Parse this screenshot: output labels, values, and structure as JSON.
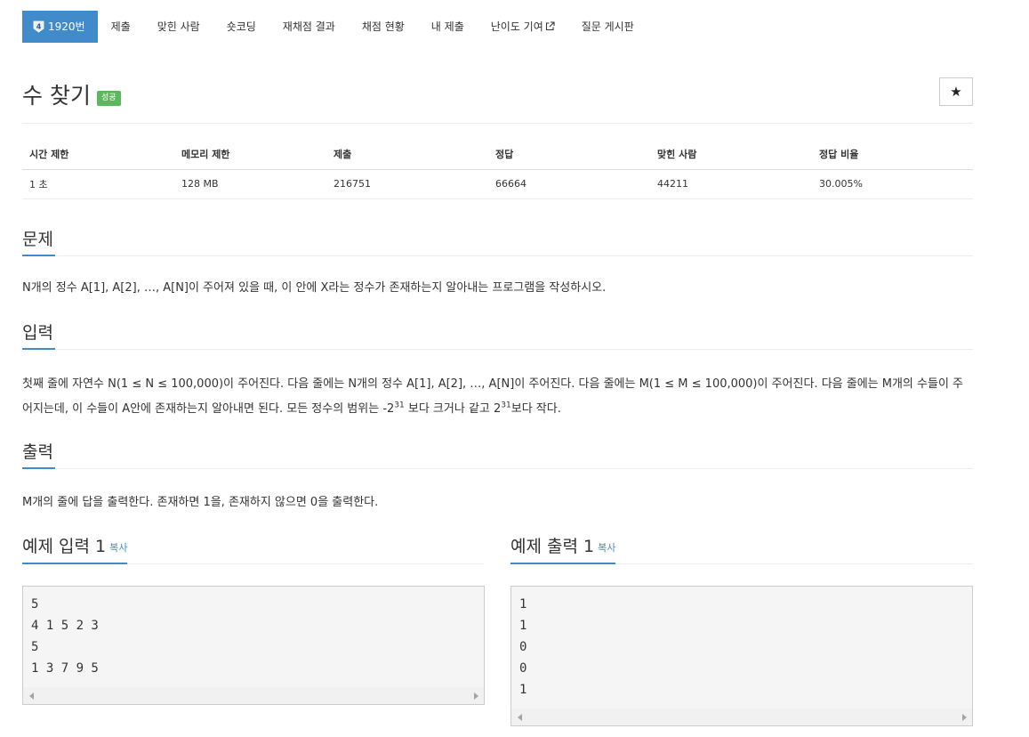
{
  "nav": {
    "active": {
      "tier": "4",
      "label": "1920번"
    },
    "items": [
      "제출",
      "맞힌 사람",
      "숏코딩",
      "재채점 결과",
      "채점 현황",
      "내 제출",
      "난이도 기여",
      "질문 게시판"
    ]
  },
  "problem": {
    "title": "수 찾기",
    "badge": "성공",
    "star": "★"
  },
  "info": {
    "headers": [
      "시간 제한",
      "메모리 제한",
      "제출",
      "정답",
      "맞힌 사람",
      "정답 비율"
    ],
    "values": [
      "1 초",
      "128 MB",
      "216751",
      "66664",
      "44211",
      "30.005%"
    ]
  },
  "sections": {
    "problem_head": "문제",
    "problem_text": "N개의 정수 A[1], A[2], …, A[N]이 주어져 있을 때, 이 안에 X라는 정수가 존재하는지 알아내는 프로그램을 작성하시오.",
    "input_head": "입력",
    "input_text_1": "첫째 줄에 자연수 N(1 ≤ N ≤ 100,000)이 주어진다. 다음 줄에는 N개의 정수 A[1], A[2], …, A[N]이 주어진다. 다음 줄에는 M(1 ≤ M ≤ 100,000)이 주어진다. 다음 줄에는 M개의 수들이 주어지는데, 이 수들이 A안에 존재하는지 알아내면 된다. 모든 정수의 범위는 -2",
    "input_sup_1": "31",
    "input_text_2": " 보다 크거나 같고 2",
    "input_sup_2": "31",
    "input_text_3": "보다 작다.",
    "output_head": "출력",
    "output_text": "M개의 줄에 답을 출력한다. 존재하면 1을, 존재하지 않으면 0을 출력한다."
  },
  "samples": {
    "input_head": "예제 입력 1",
    "output_head": "예제 출력 1",
    "copy_label": "복사",
    "input_text": "5\n4 1 5 2 3\n5\n1 3 7 9 5",
    "output_text": "1\n1\n0\n0\n1"
  },
  "colors": {
    "accent": "#428bca",
    "success": "#5cb85c"
  }
}
